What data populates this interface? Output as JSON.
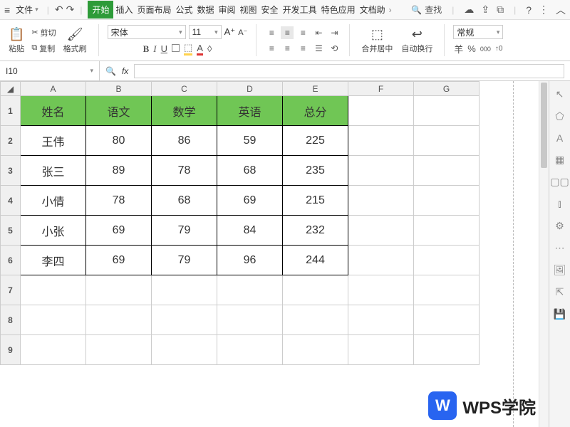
{
  "menu": {
    "file": "文件",
    "tabs": [
      "开始",
      "插入",
      "页面布局",
      "公式",
      "数据",
      "审阅",
      "视图",
      "安全",
      "开发工具",
      "特色应用",
      "文档助"
    ],
    "active_tab": "开始",
    "search": "查找"
  },
  "toolbar": {
    "paste": "粘贴",
    "cut": "剪切",
    "copy": "复制",
    "format_painter": "格式刷",
    "font_name": "宋体",
    "font_size": "11",
    "merge": "合并居中",
    "wrap": "自动换行",
    "number_format": "常规",
    "currency": "羊",
    "percent": "%",
    "thousand": "000",
    "inc_dec": "↑0"
  },
  "namebox": {
    "cell_ref": "I10",
    "fx": "fx"
  },
  "columns": [
    "A",
    "B",
    "C",
    "D",
    "E",
    "F",
    "G"
  ],
  "rows": [
    "1",
    "2",
    "3",
    "4",
    "5",
    "6",
    "7",
    "8",
    "9"
  ],
  "table": {
    "headers": [
      "姓名",
      "语文",
      "数学",
      "英语",
      "总分"
    ],
    "data": [
      [
        "王伟",
        "80",
        "86",
        "59",
        "225"
      ],
      [
        "张三",
        "89",
        "78",
        "68",
        "235"
      ],
      [
        "小倩",
        "78",
        "68",
        "69",
        "215"
      ],
      [
        "小张",
        "69",
        "79",
        "84",
        "232"
      ],
      [
        "李四",
        "69",
        "79",
        "96",
        "244"
      ]
    ]
  },
  "watermark": "WPS学院",
  "side_icons": [
    "cursor",
    "pentagon",
    "A",
    "grid",
    "apps",
    "chart",
    "gear",
    "ellipsis",
    "image",
    "share",
    "save"
  ]
}
